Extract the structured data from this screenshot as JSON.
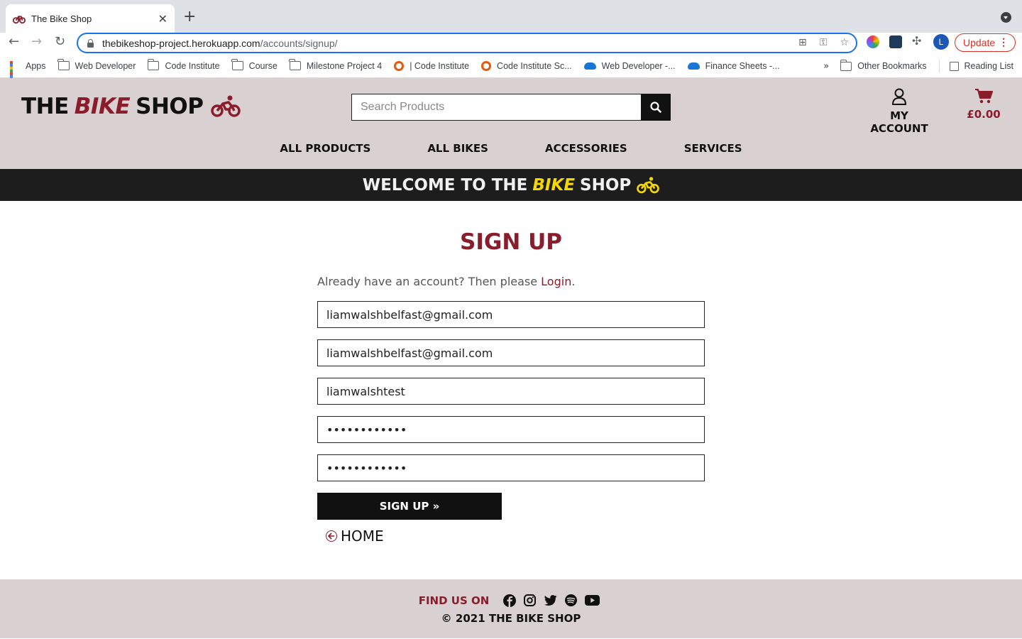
{
  "browser": {
    "tab_title": "The Bike Shop",
    "url_host": "thebikeshop-project.herokuapp.com",
    "url_path": "/accounts/signup/",
    "update_label": "Update",
    "profile_initial": "L",
    "bookmarks": [
      {
        "label": "Apps",
        "icon": "apps-icon"
      },
      {
        "label": "Web Developer",
        "icon": "folder-icon"
      },
      {
        "label": "Code Institute",
        "icon": "folder-icon"
      },
      {
        "label": "Course",
        "icon": "folder-icon"
      },
      {
        "label": "Milestone Project 4",
        "icon": "folder-icon"
      },
      {
        "label": "| Code Institute",
        "icon": "code-institute-icon"
      },
      {
        "label": "Code Institute Sc...",
        "icon": "code-institute-icon"
      },
      {
        "label": "Web Developer -...",
        "icon": "onedrive-icon"
      },
      {
        "label": "Finance Sheets -...",
        "icon": "onedrive-icon"
      }
    ],
    "other_bookmarks": "Other Bookmarks",
    "reading_list": "Reading List"
  },
  "site": {
    "logo_pre": "THE",
    "logo_bike": "BIKE",
    "logo_post": "SHOP",
    "search_placeholder": "Search Products",
    "account_label": "MY ACCOUNT",
    "cart_total": "£0.00",
    "nav": [
      "ALL PRODUCTS",
      "ALL BIKES",
      "ACCESSORIES",
      "SERVICES"
    ],
    "banner_pre": "WELCOME TO THE",
    "banner_bike": "BIKE",
    "banner_post": "SHOP",
    "brand_color": "#8a1c2c",
    "accent_color": "#f5d800"
  },
  "signup": {
    "heading": "SIGN UP",
    "intro_text": "Already have an account? Then please ",
    "login_link": "Login",
    "intro_end": ".",
    "email": "liamwalshbelfast@gmail.com",
    "email_confirm": "liamwalshbelfast@gmail.com",
    "username": "liamwalshtest",
    "password": "••••••••••••",
    "password_confirm": "••••••••••••",
    "submit_label": "SIGN UP »",
    "home_label": "HOME"
  },
  "footer": {
    "find_us": "FIND US ON",
    "social": [
      "facebook-icon",
      "instagram-icon",
      "twitter-icon",
      "spotify-icon",
      "youtube-icon"
    ],
    "copyright": "© 2021 THE BIKE SHOP"
  }
}
